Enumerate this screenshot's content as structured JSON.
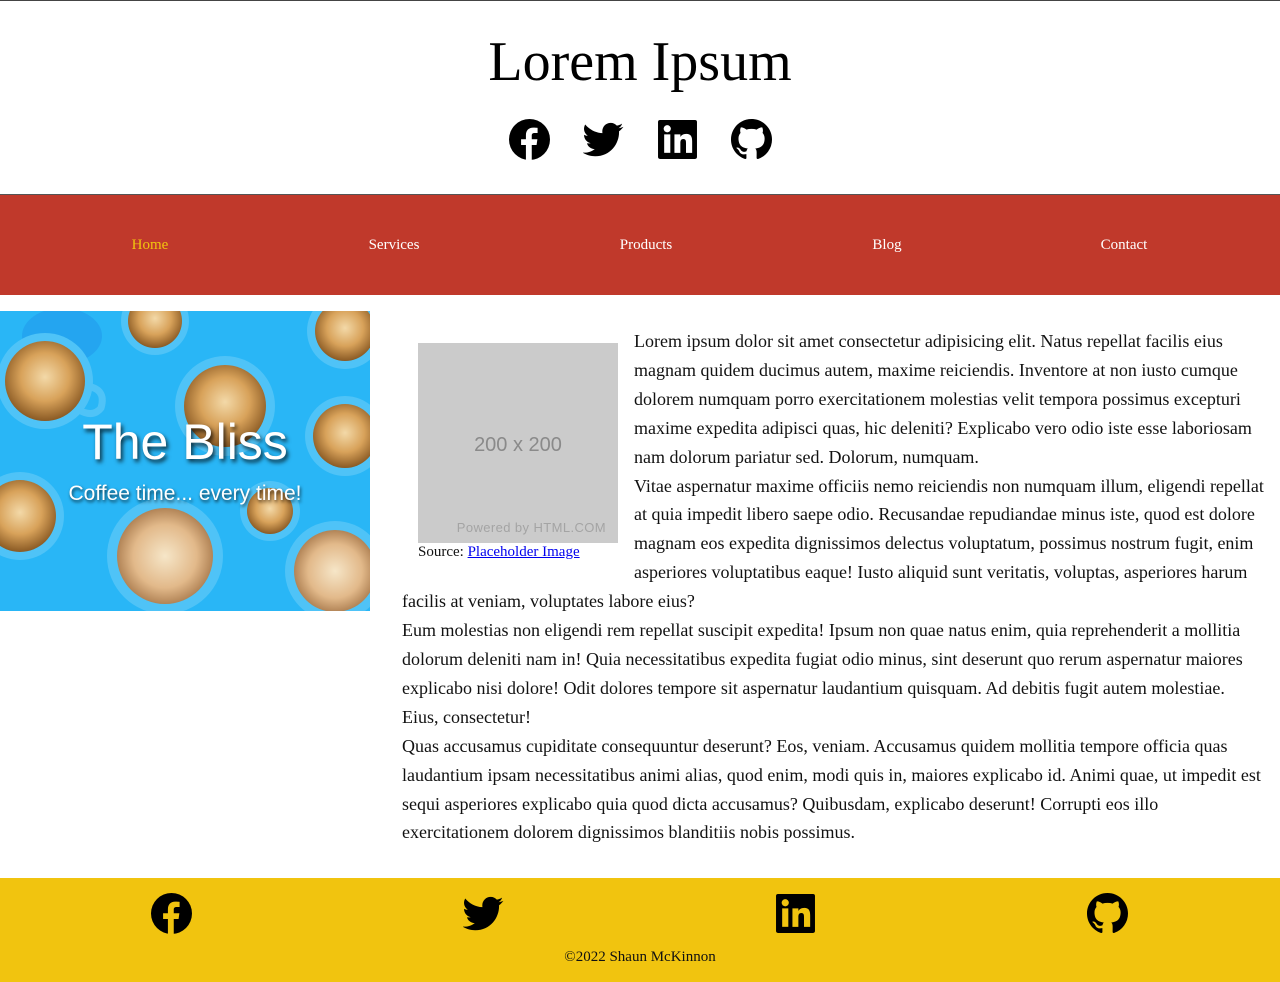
{
  "header": {
    "title": "Lorem Ipsum",
    "social_icons": [
      "facebook-icon",
      "twitter-icon",
      "linkedin-icon",
      "github-icon"
    ]
  },
  "nav": {
    "items": [
      {
        "label": "Home",
        "active": true
      },
      {
        "label": "Services",
        "active": false
      },
      {
        "label": "Products",
        "active": false
      },
      {
        "label": "Blog",
        "active": false
      },
      {
        "label": "Contact",
        "active": false
      }
    ]
  },
  "hero": {
    "title": "The Bliss",
    "subtitle": "Coffee time... every time!"
  },
  "figure": {
    "size_text": "200 x 200",
    "powered_text": "Powered by HTML.COM",
    "source_prefix": "Source:",
    "source_link": "Placeholder Image"
  },
  "content": {
    "paragraphs": [
      "Lorem ipsum dolor sit amet consectetur adipisicing elit. Natus repellat facilis eius magnam quidem ducimus autem, maxime reiciendis. Inventore at non iusto cumque dolorem numquam porro exercitationem molestias velit tempora possimus excepturi maxime expedita adipisci quas, hic deleniti? Explicabo vero odio iste esse laboriosam nam dolorum pariatur sed. Dolorum, numquam.",
      "Vitae aspernatur maxime officiis nemo reiciendis non numquam illum, eligendi repellat at quia impedit libero saepe odio. Recusandae repudiandae minus iste, quod est dolore magnam eos expedita dignissimos delectus voluptatum, possimus nostrum fugit, enim asperiores voluptatibus eaque! Iusto aliquid sunt veritatis, voluptas, asperiores harum facilis at veniam, voluptates labore eius?",
      "Eum molestias non eligendi rem repellat suscipit expedita! Ipsum non quae natus enim, quia reprehenderit a mollitia dolorum deleniti nam in! Quia necessitatibus expedita fugiat odio minus, sint deserunt quo rerum aspernatur maiores explicabo nisi dolore! Odit dolores tempore sit aspernatur laudantium quisquam. Ad debitis fugit autem molestiae. Eius, consectetur!",
      "Quas accusamus cupiditate consequuntur deserunt? Eos, veniam. Accusamus quidem mollitia tempore officia quas laudantium ipsam necessitatibus animi alias, quod enim, modi quis in, maiores explicabo id. Animi quae, ut impedit est sequi asperiores explicabo quia quod dicta accusamus? Quibusdam, explicabo deserunt! Corrupti eos illo exercitationem dolorem dignissimos blanditiis nobis possimus."
    ]
  },
  "footer": {
    "social_icons": [
      "facebook-icon",
      "twitter-icon",
      "linkedin-icon",
      "github-icon"
    ],
    "copyright": "©2022 Shaun McKinnon"
  },
  "colors": {
    "nav_bg": "#c0392b",
    "nav_active": "#f1c40f",
    "footer_bg": "#f1c40f",
    "hero_bg": "#29b6f6",
    "placeholder_bg": "#cbcbcb"
  }
}
